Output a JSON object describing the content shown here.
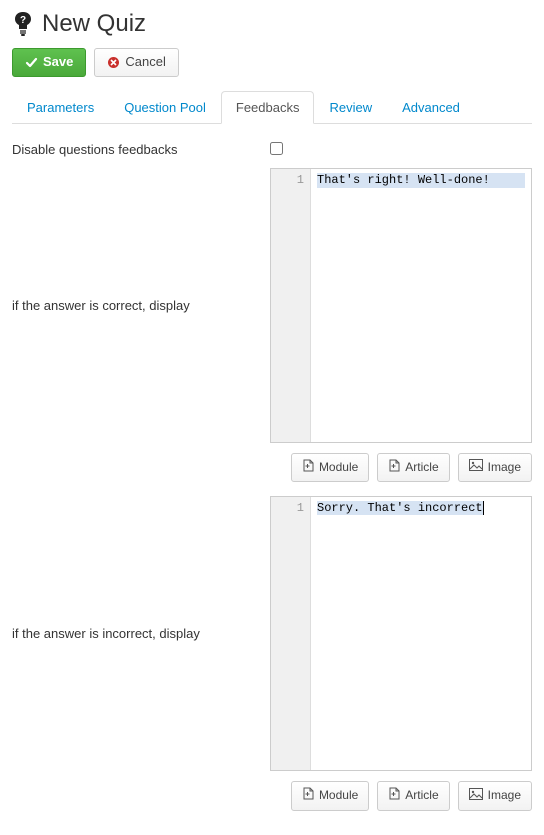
{
  "header": {
    "title": "New Quiz"
  },
  "actions": {
    "save_label": "Save",
    "cancel_label": "Cancel"
  },
  "tabs": {
    "parameters": "Parameters",
    "question_pool": "Question Pool",
    "feedbacks": "Feedbacks",
    "review": "Review",
    "advanced": "Advanced"
  },
  "form": {
    "disable_feedbacks_label": "Disable questions feedbacks",
    "correct_label": "if the answer is correct, display",
    "incorrect_label": "if the answer is incorrect, display"
  },
  "editor1": {
    "line_number": "1",
    "content": "That's right! Well-done!"
  },
  "editor2": {
    "line_number": "1",
    "content": "Sorry. That's incorrect"
  },
  "toolbar": {
    "module_label": "Module",
    "article_label": "Article",
    "image_label": "Image"
  }
}
